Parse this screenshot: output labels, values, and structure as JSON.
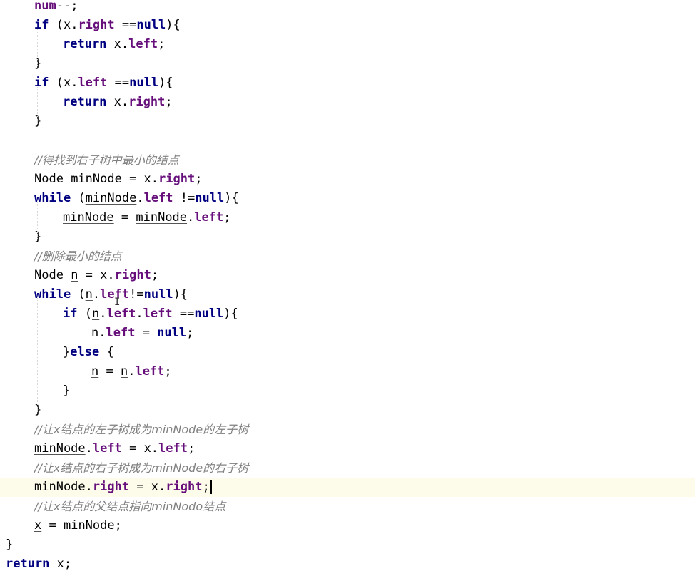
{
  "editor": {
    "current_line_color": "#fdfbe9",
    "colors": {
      "keyword": "#000080",
      "field": "#660e7a",
      "comment": "#808080",
      "plain": "#000000"
    },
    "lines": [
      {
        "indent": 48,
        "tokens": [
          {
            "t": "num",
            "k": "field"
          },
          {
            "t": "--;",
            "k": "plain"
          }
        ]
      },
      {
        "indent": 48,
        "tokens": [
          {
            "t": "if",
            "k": "kw"
          },
          {
            "t": " (x.",
            "k": "plain"
          },
          {
            "t": "right",
            "k": "field"
          },
          {
            "t": " ==",
            "k": "plain"
          },
          {
            "t": "null",
            "k": "kw"
          },
          {
            "t": "){",
            "k": "plain"
          }
        ]
      },
      {
        "indent": 88,
        "tokens": [
          {
            "t": "return",
            "k": "kw"
          },
          {
            "t": " x.",
            "k": "plain"
          },
          {
            "t": "left",
            "k": "field"
          },
          {
            "t": ";",
            "k": "plain"
          }
        ]
      },
      {
        "indent": 48,
        "tokens": [
          {
            "t": "}",
            "k": "plain"
          }
        ]
      },
      {
        "indent": 48,
        "tokens": [
          {
            "t": "if",
            "k": "kw"
          },
          {
            "t": " (x.",
            "k": "plain"
          },
          {
            "t": "left",
            "k": "field"
          },
          {
            "t": " ==",
            "k": "plain"
          },
          {
            "t": "null",
            "k": "kw"
          },
          {
            "t": "){",
            "k": "plain"
          }
        ]
      },
      {
        "indent": 88,
        "tokens": [
          {
            "t": "return",
            "k": "kw"
          },
          {
            "t": " x.",
            "k": "plain"
          },
          {
            "t": "right",
            "k": "field"
          },
          {
            "t": ";",
            "k": "plain"
          }
        ]
      },
      {
        "indent": 48,
        "tokens": [
          {
            "t": "}",
            "k": "plain"
          }
        ]
      },
      {
        "indent": 48,
        "tokens": []
      },
      {
        "indent": 48,
        "tokens": [
          {
            "t": "//得找到右子树中最小的结点",
            "k": "cmt"
          }
        ]
      },
      {
        "indent": 48,
        "tokens": [
          {
            "t": "Node ",
            "k": "plain"
          },
          {
            "t": "minNode",
            "k": "plain",
            "u": true
          },
          {
            "t": " = x.",
            "k": "plain"
          },
          {
            "t": "right",
            "k": "field"
          },
          {
            "t": ";",
            "k": "plain"
          }
        ]
      },
      {
        "indent": 48,
        "tokens": [
          {
            "t": "while",
            "k": "kw"
          },
          {
            "t": " (",
            "k": "plain"
          },
          {
            "t": "minNode",
            "k": "plain",
            "u": true
          },
          {
            "t": ".",
            "k": "plain"
          },
          {
            "t": "left",
            "k": "field"
          },
          {
            "t": " !=",
            "k": "plain"
          },
          {
            "t": "null",
            "k": "kw"
          },
          {
            "t": "){",
            "k": "plain"
          }
        ]
      },
      {
        "indent": 88,
        "tokens": [
          {
            "t": "minNode",
            "k": "plain",
            "u": true
          },
          {
            "t": " = ",
            "k": "plain"
          },
          {
            "t": "minNode",
            "k": "plain",
            "u": true
          },
          {
            "t": ".",
            "k": "plain"
          },
          {
            "t": "left",
            "k": "field"
          },
          {
            "t": ";",
            "k": "plain"
          }
        ]
      },
      {
        "indent": 48,
        "tokens": [
          {
            "t": "}",
            "k": "plain"
          }
        ]
      },
      {
        "indent": 48,
        "tokens": [
          {
            "t": "//删除最小的结点",
            "k": "cmt"
          }
        ]
      },
      {
        "indent": 48,
        "tokens": [
          {
            "t": "Node ",
            "k": "plain"
          },
          {
            "t": "n",
            "k": "plain",
            "u": true
          },
          {
            "t": " = x.",
            "k": "plain"
          },
          {
            "t": "right",
            "k": "field"
          },
          {
            "t": ";",
            "k": "plain"
          }
        ]
      },
      {
        "indent": 48,
        "tokens": [
          {
            "t": "while",
            "k": "kw"
          },
          {
            "t": " (",
            "k": "plain"
          },
          {
            "t": "n",
            "k": "plain",
            "u": true
          },
          {
            "t": ".",
            "k": "plain"
          },
          {
            "t": "left",
            "k": "field"
          },
          {
            "t": "!=",
            "k": "plain"
          },
          {
            "t": "null",
            "k": "kw"
          },
          {
            "t": "){",
            "k": "plain"
          }
        ]
      },
      {
        "indent": 88,
        "tokens": [
          {
            "t": "if",
            "k": "kw"
          },
          {
            "t": " (",
            "k": "plain"
          },
          {
            "t": "n",
            "k": "plain",
            "u": true
          },
          {
            "t": ".",
            "k": "plain"
          },
          {
            "t": "left",
            "k": "field"
          },
          {
            "t": ".",
            "k": "plain"
          },
          {
            "t": "left",
            "k": "field"
          },
          {
            "t": " ==",
            "k": "plain"
          },
          {
            "t": "null",
            "k": "kw"
          },
          {
            "t": "){",
            "k": "plain"
          }
        ]
      },
      {
        "indent": 128,
        "tokens": [
          {
            "t": "n",
            "k": "plain",
            "u": true
          },
          {
            "t": ".",
            "k": "plain"
          },
          {
            "t": "left",
            "k": "field"
          },
          {
            "t": " = ",
            "k": "plain"
          },
          {
            "t": "null",
            "k": "kw"
          },
          {
            "t": ";",
            "k": "plain"
          }
        ]
      },
      {
        "indent": 88,
        "tokens": [
          {
            "t": "}",
            "k": "plain"
          },
          {
            "t": "else",
            "k": "kw"
          },
          {
            "t": " {",
            "k": "plain"
          }
        ]
      },
      {
        "indent": 128,
        "tokens": [
          {
            "t": "n",
            "k": "plain",
            "u": true
          },
          {
            "t": " = ",
            "k": "plain"
          },
          {
            "t": "n",
            "k": "plain",
            "u": true
          },
          {
            "t": ".",
            "k": "plain"
          },
          {
            "t": "left",
            "k": "field"
          },
          {
            "t": ";",
            "k": "plain"
          }
        ]
      },
      {
        "indent": 88,
        "tokens": [
          {
            "t": "}",
            "k": "plain"
          }
        ]
      },
      {
        "indent": 48,
        "tokens": [
          {
            "t": "}",
            "k": "plain"
          }
        ]
      },
      {
        "indent": 48,
        "tokens": [
          {
            "t": "//让x结点的左子树成为minNode的左子树",
            "k": "cmt"
          }
        ]
      },
      {
        "indent": 48,
        "tokens": [
          {
            "t": "minNode",
            "k": "plain",
            "u": true
          },
          {
            "t": ".",
            "k": "plain"
          },
          {
            "t": "left",
            "k": "field"
          },
          {
            "t": " = x.",
            "k": "plain"
          },
          {
            "t": "left",
            "k": "field"
          },
          {
            "t": ";",
            "k": "plain"
          }
        ]
      },
      {
        "indent": 48,
        "tokens": [
          {
            "t": "//让x结点的右子树成为minNode的右子树",
            "k": "cmt"
          }
        ]
      },
      {
        "indent": 48,
        "current": true,
        "caret": true,
        "tokens": [
          {
            "t": "minNode",
            "k": "plain",
            "u": true
          },
          {
            "t": ".",
            "k": "plain"
          },
          {
            "t": "right",
            "k": "field"
          },
          {
            "t": " = x.",
            "k": "plain"
          },
          {
            "t": "right",
            "k": "field"
          },
          {
            "t": ";",
            "k": "plain"
          }
        ]
      },
      {
        "indent": 48,
        "tokens": [
          {
            "t": "//让x结点的父结点指向minNodo结点",
            "k": "cmt"
          }
        ]
      },
      {
        "indent": 48,
        "tokens": [
          {
            "t": "x",
            "k": "plain",
            "u": true
          },
          {
            "t": " = ",
            "k": "plain"
          },
          {
            "t": "minNode",
            "k": "plain"
          },
          {
            "t": ";",
            "k": "plain"
          }
        ]
      },
      {
        "indent": 8,
        "tokens": [
          {
            "t": "}",
            "k": "plain"
          }
        ]
      },
      {
        "indent": 8,
        "tokens": [
          {
            "t": "return",
            "k": "kw"
          },
          {
            "t": " ",
            "k": "plain"
          },
          {
            "t": "x",
            "k": "plain",
            "u": true
          },
          {
            "t": ";",
            "k": "plain"
          }
        ]
      }
    ]
  }
}
